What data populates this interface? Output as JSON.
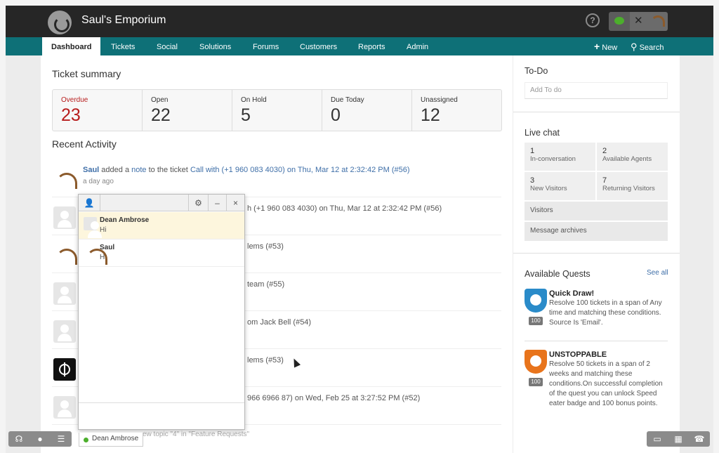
{
  "app": {
    "title": "Saul's Emporium"
  },
  "nav": {
    "tabs": [
      "Dashboard",
      "Tickets",
      "Social",
      "Solutions",
      "Forums",
      "Customers",
      "Reports",
      "Admin"
    ],
    "new_label": "New",
    "search_label": "Search"
  },
  "summary": {
    "title": "Ticket summary",
    "cells": [
      {
        "label": "Overdue",
        "value": "23"
      },
      {
        "label": "Open",
        "value": "22"
      },
      {
        "label": "On Hold",
        "value": "5"
      },
      {
        "label": "Due Today",
        "value": "0"
      },
      {
        "label": "Unassigned",
        "value": "12"
      }
    ]
  },
  "activity": {
    "title": "Recent Activity",
    "items": [
      {
        "user": "Saul",
        "verb": "added a",
        "object": "note",
        "rest": "to the ticket",
        "ticket": "Call with (+1 960 083 4030) on Thu, Mar 12 at 2:32:42 PM (#56)",
        "time": "a day ago"
      },
      {
        "visible": "h (+1 960 083 4030) on Thu, Mar 12 at 2:32:42 PM (#56)"
      },
      {
        "visible": "lems (#53)"
      },
      {
        "visible": "team (#55)"
      },
      {
        "visible": "om Jack Bell (#54)"
      },
      {
        "visible": "lems (#53)"
      },
      {
        "visible": "966 6966 87) on Wed, Feb 25 at 3:27:52 PM (#52)"
      },
      {
        "visible": "ew topic \"4\" in \"Feature Requests\""
      }
    ]
  },
  "todo": {
    "title": "To-Do",
    "placeholder": "Add To do"
  },
  "livechat": {
    "title": "Live chat",
    "stats": [
      {
        "n": "1",
        "label": "In-conversation"
      },
      {
        "n": "2",
        "label": "Available Agents"
      },
      {
        "n": "3",
        "label": "New Visitors"
      },
      {
        "n": "7",
        "label": "Returning Visitors"
      }
    ],
    "links": [
      "Visitors",
      "Message archives"
    ]
  },
  "quests": {
    "title": "Available Quests",
    "see_all": "See all",
    "items": [
      {
        "name": "Quick Draw!",
        "points": "100",
        "desc": "Resolve 100 tickets in a span of Any time and matching these conditions. Source Is 'Email'.",
        "color": "#2a8bc9"
      },
      {
        "name": "UNSTOPPABLE",
        "points": "100",
        "desc": "Resolve 50 tickets in a span of 2 weeks and matching these conditions.On successful completion of the quest you can unlock Speed eater badge and 100 bonus points.",
        "color": "#e8741c"
      }
    ]
  },
  "chat": {
    "conversations": [
      {
        "name": "Dean Ambrose",
        "message": "Hi"
      },
      {
        "name": "Saul",
        "message": "Hi"
      }
    ],
    "minimized_label": "Dean Ambrose"
  },
  "colors": {
    "nav": "#0e7077",
    "topbar": "#262626",
    "link": "#3f6fa8",
    "overdue": "#b71c1c"
  }
}
